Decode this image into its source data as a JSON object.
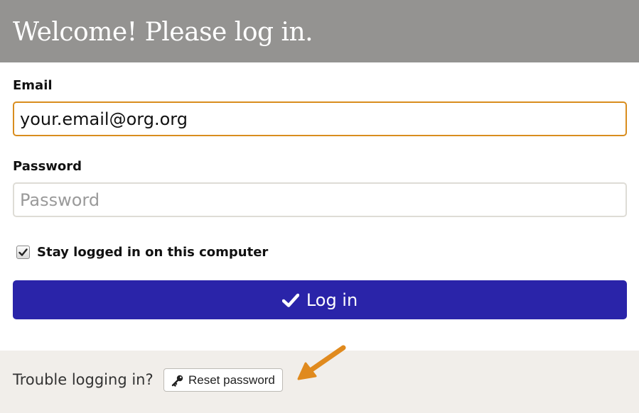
{
  "header": {
    "title": "Welcome! Please log in."
  },
  "form": {
    "email": {
      "label": "Email",
      "value": "your.email@org.org"
    },
    "password": {
      "label": "Password",
      "value": "",
      "placeholder": "Password"
    },
    "stay_logged_in": {
      "label": "Stay logged in on this computer",
      "checked": true
    },
    "login_button": {
      "label": "Log in",
      "icon": "check-icon"
    }
  },
  "footer": {
    "trouble_text": "Trouble logging in?",
    "reset_button": {
      "label": "Reset password",
      "icon": "key-icon"
    }
  },
  "colors": {
    "header_bg": "#949391",
    "primary_button": "#2a24a9",
    "focus_border": "#d98d1e",
    "footer_bg": "#f1eeea",
    "annotation_arrow": "#e08a1e"
  }
}
